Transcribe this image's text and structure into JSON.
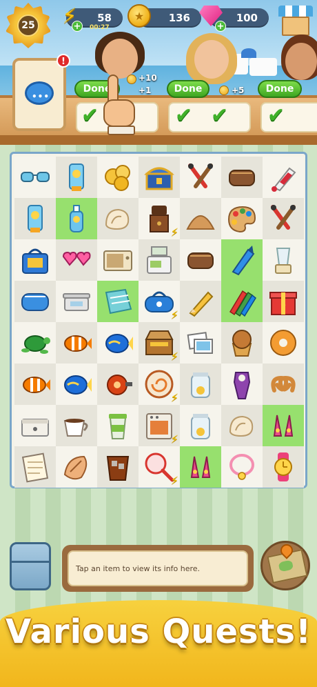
{
  "hud": {
    "level": "25",
    "energy": "58",
    "energy_timer": "00:27",
    "coins": "136",
    "gems": "100",
    "plus": "+"
  },
  "notes": {
    "alert": "!"
  },
  "quests": [
    {
      "button": "Done",
      "reward_coins": "+10",
      "reward_extra": "+1"
    },
    {
      "button": "Done",
      "reward_coins": "+5"
    },
    {
      "button": "Done"
    }
  ],
  "board": {
    "rows": [
      [
        "sunglasses",
        "sunscreen-tube",
        "gold-coins",
        "treasure-chest",
        "paint-brushes",
        "makeup-bag",
        "paint-tube"
      ],
      [
        "sunscreen-tube",
        "sunscreen-bottle",
        "seashell",
        "coffee-grinder",
        "sand-pile",
        "paint-palette",
        "paint-brushes"
      ],
      [
        "cooler-bag",
        "heart-sunglasses",
        "microwave",
        "cash-register",
        "makeup-bag",
        "crayon",
        "blender"
      ],
      [
        "toiletry-bag",
        "kitchen-scale",
        "beach-towel",
        "duffel-bag",
        "pencil",
        "crayons",
        "gift-box"
      ],
      [
        "sea-turtle",
        "clownfish",
        "tropical-fish",
        "tackle-box",
        "photos",
        "muffin",
        "donut"
      ],
      [
        "clownfish",
        "tropical-fish",
        "fishing-reel",
        "cake-roll",
        "tip-jar",
        "bottle-opener",
        "pretzel"
      ],
      [
        "cash-box",
        "coffee-cup",
        "coffee-to-go",
        "oven",
        "tip-jar",
        "seashell",
        "flower-earrings"
      ],
      [
        "notepad",
        "conch-shell",
        "iced-tea",
        "butterfly-net",
        "flower-earrings",
        "necklace",
        "watch"
      ]
    ],
    "highlight": [
      [
        1,
        1
      ],
      [
        2,
        5
      ],
      [
        3,
        2
      ],
      [
        3,
        5
      ],
      [
        6,
        6
      ],
      [
        7,
        4
      ]
    ],
    "energized": [
      [
        1,
        3
      ],
      [
        3,
        3
      ],
      [
        4,
        3
      ],
      [
        5,
        3
      ],
      [
        6,
        3
      ],
      [
        7,
        3
      ]
    ]
  },
  "info_text": "Tap an item to view its info here.",
  "banner_title": "Various Quests!",
  "colors": {
    "done_green": "#3fa622",
    "banner_yellow": "#f7d13e",
    "board_border": "#7aa6c9",
    "highlight_green": "#97e06e"
  }
}
